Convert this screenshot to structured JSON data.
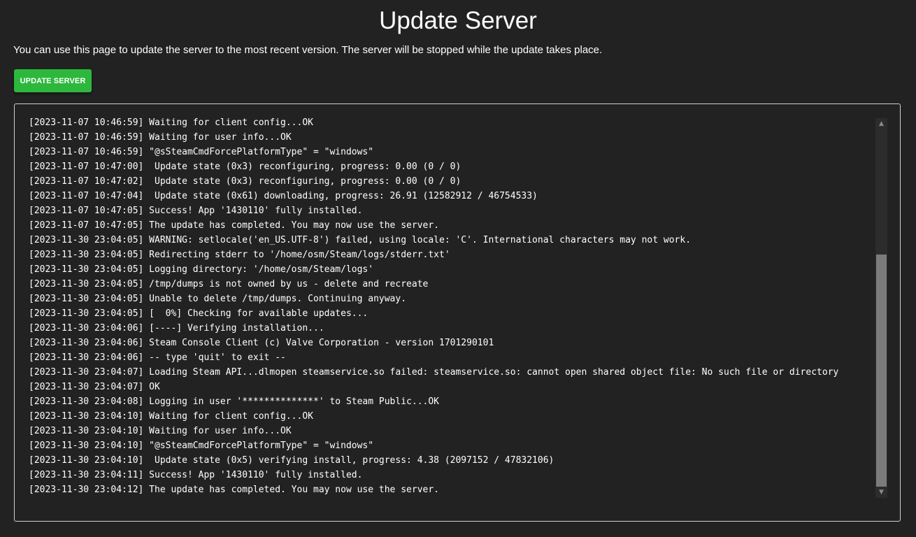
{
  "header": {
    "title": "Update Server",
    "description": "You can use this page to update the server to the most recent version. The server will be stopped while the update takes place."
  },
  "actions": {
    "update_button_label": "UPDATE SERVER"
  },
  "colors": {
    "background": "#222222",
    "button": "#2db83d",
    "border": "#cfcfcf",
    "scroll_thumb": "#7b7b7b"
  },
  "icons": {
    "scroll_up": "chevron-up-icon",
    "scroll_down": "chevron-down-icon"
  },
  "log": {
    "scroll_position": {
      "start_fraction": 0.35,
      "visible_fraction": 0.65
    },
    "lines": [
      "[2023-11-07 10:46:59] Waiting for client config...OK",
      "[2023-11-07 10:46:59] Waiting for user info...OK",
      "[2023-11-07 10:46:59] \"@sSteamCmdForcePlatformType\" = \"windows\"",
      "[2023-11-07 10:47:00]  Update state (0x3) reconfiguring, progress: 0.00 (0 / 0)",
      "[2023-11-07 10:47:02]  Update state (0x3) reconfiguring, progress: 0.00 (0 / 0)",
      "[2023-11-07 10:47:04]  Update state (0x61) downloading, progress: 26.91 (12582912 / 46754533)",
      "[2023-11-07 10:47:05] Success! App '1430110' fully installed.",
      "[2023-11-07 10:47:05] The update has completed. You may now use the server.",
      "[2023-11-30 23:04:05] WARNING: setlocale('en_US.UTF-8') failed, using locale: 'C'. International characters may not work.",
      "[2023-11-30 23:04:05] Redirecting stderr to '/home/osm/Steam/logs/stderr.txt'",
      "[2023-11-30 23:04:05] Logging directory: '/home/osm/Steam/logs'",
      "[2023-11-30 23:04:05] /tmp/dumps is not owned by us - delete and recreate",
      "[2023-11-30 23:04:05] Unable to delete /tmp/dumps. Continuing anyway.",
      "[2023-11-30 23:04:05] [  0%] Checking for available updates...",
      "[2023-11-30 23:04:06] [----] Verifying installation...",
      "[2023-11-30 23:04:06] Steam Console Client (c) Valve Corporation - version 1701290101",
      "[2023-11-30 23:04:06] -- type 'quit' to exit --",
      "[2023-11-30 23:04:07] Loading Steam API...dlmopen steamservice.so failed: steamservice.so: cannot open shared object file: No such file or directory",
      "[2023-11-30 23:04:07] OK",
      "[2023-11-30 23:04:08] Logging in user '**************' to Steam Public...OK",
      "[2023-11-30 23:04:10] Waiting for client config...OK",
      "[2023-11-30 23:04:10] Waiting for user info...OK",
      "[2023-11-30 23:04:10] \"@sSteamCmdForcePlatformType\" = \"windows\"",
      "[2023-11-30 23:04:10]  Update state (0x5) verifying install, progress: 4.38 (2097152 / 47832106)",
      "[2023-11-30 23:04:11] Success! App '1430110' fully installed.",
      "[2023-11-30 23:04:12] The update has completed. You may now use the server."
    ]
  }
}
